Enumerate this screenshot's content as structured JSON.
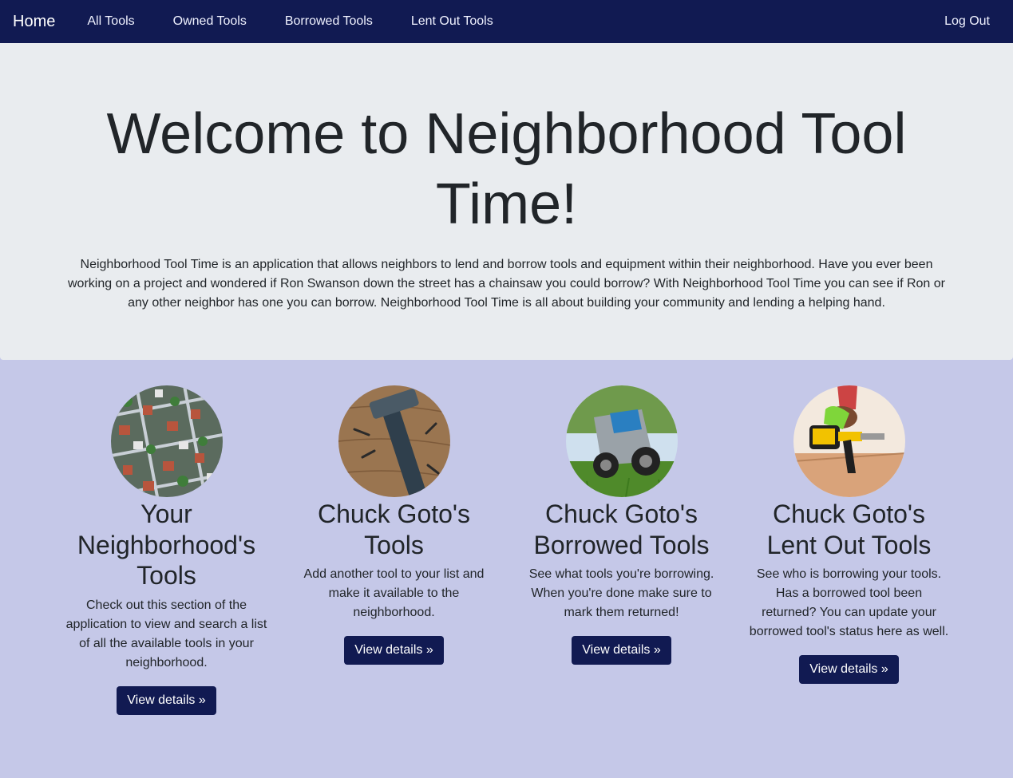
{
  "nav": {
    "brand": "Home",
    "links": [
      "All Tools",
      "Owned Tools",
      "Borrowed Tools",
      "Lent Out Tools"
    ],
    "logout": "Log Out"
  },
  "jumbotron": {
    "title": "Welcome to Neighborhood Tool Time!",
    "text": "Neighborhood Tool Time is an application that allows neighbors to lend and borrow tools and equipment within their neighborhood. Have you ever been working on a project and wondered if Ron Swanson down the street has a chainsaw you could borrow? With Neighborhood Tool Time you can see if Ron or any other neighbor has one you can borrow. Neighborhood Tool Time is all about building your community and lending a helping hand."
  },
  "features": [
    {
      "image": "neighborhood-aerial-image",
      "title": "Your Neighborhood's Tools",
      "text": "Check out this section of the application to view and search a list of all the available tools in your neighborhood.",
      "button": "View details »"
    },
    {
      "image": "hammer-image",
      "title": "Chuck Goto's Tools",
      "text": "Add another tool to your list and make it available to the neighborhood.",
      "button": "View details »"
    },
    {
      "image": "lawn-mower-image",
      "title": "Chuck Goto's Borrowed Tools",
      "text": "See what tools you're borrowing. When you're done make sure to mark them returned!",
      "button": "View details »"
    },
    {
      "image": "power-drill-image",
      "title": "Chuck Goto's Lent Out Tools",
      "text": "See who is borrowing your tools. Has a borrowed tool been returned? You can update your borrowed tool's status here as well.",
      "button": "View details »"
    }
  ],
  "colors": {
    "navbar": "#111a52",
    "jumbotron": "#e9ecef",
    "page_background": "#c5c8e8",
    "button": "#111a52"
  }
}
